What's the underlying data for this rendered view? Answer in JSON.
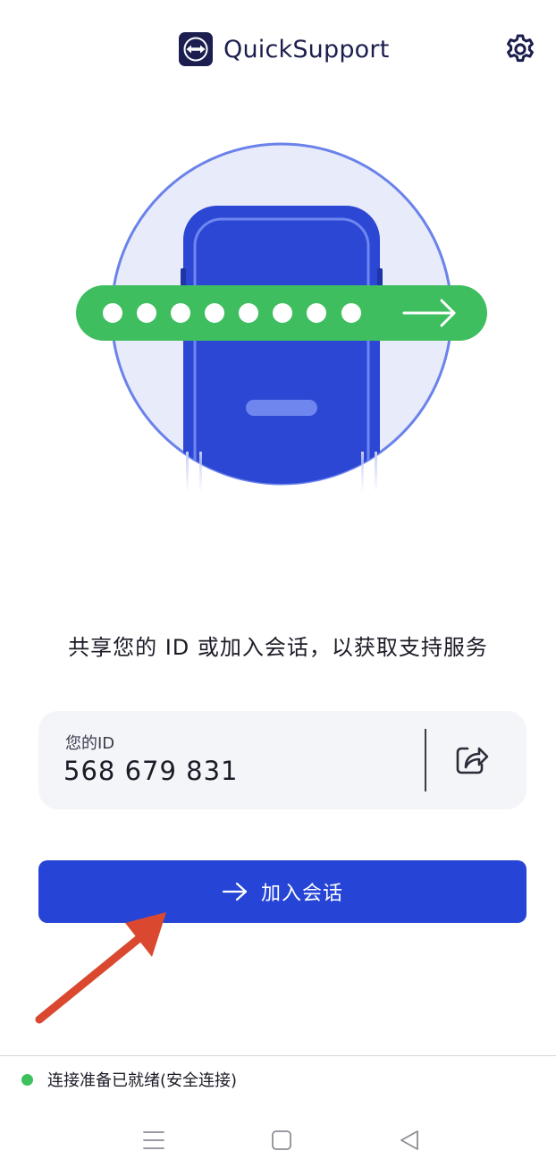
{
  "header": {
    "app_name": "QuickSupport"
  },
  "main": {
    "prompt": "共享您的 ID 或加入会话，以获取支持服务",
    "id_card": {
      "label": "您的ID",
      "value": "568 679 831"
    },
    "join_button": {
      "label": "加入会话"
    }
  },
  "status": {
    "text": "连接准备已就绪(安全连接)"
  },
  "icons": {
    "logo": "teamviewer-logo-icon",
    "settings": "gear-icon",
    "share": "share-icon",
    "join": "arrow-right-icon",
    "nav_menu": "menu-icon",
    "nav_home": "home-square-icon",
    "nav_back": "back-triangle-icon"
  },
  "colors": {
    "brand_blue": "#2645d6",
    "dark_navy": "#1b1e4e",
    "status_green": "#3cc15c",
    "illustration_bar_green": "#3fbe5f",
    "annotation_red": "#d9482f"
  }
}
